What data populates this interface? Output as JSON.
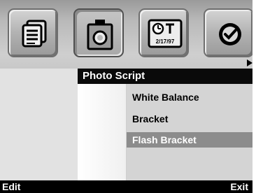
{
  "toolbar": {
    "icons": [
      {
        "name": "notes-icon",
        "selected": false
      },
      {
        "name": "camera-icon",
        "selected": true
      },
      {
        "name": "calendar-icon",
        "selected": false,
        "label": "2/17/97"
      },
      {
        "name": "checkmark-icon",
        "selected": false
      }
    ]
  },
  "menu": {
    "title": "Photo Script",
    "items": [
      {
        "label": "White Balance",
        "highlighted": false
      },
      {
        "label": "Bracket",
        "highlighted": false
      },
      {
        "label": "Flash Bracket",
        "highlighted": true
      }
    ]
  },
  "softkeys": {
    "left": "Edit",
    "right": "Exit"
  },
  "colors": {
    "highlight": "#8c8c8c",
    "title_bg": "#0a0a0a"
  }
}
